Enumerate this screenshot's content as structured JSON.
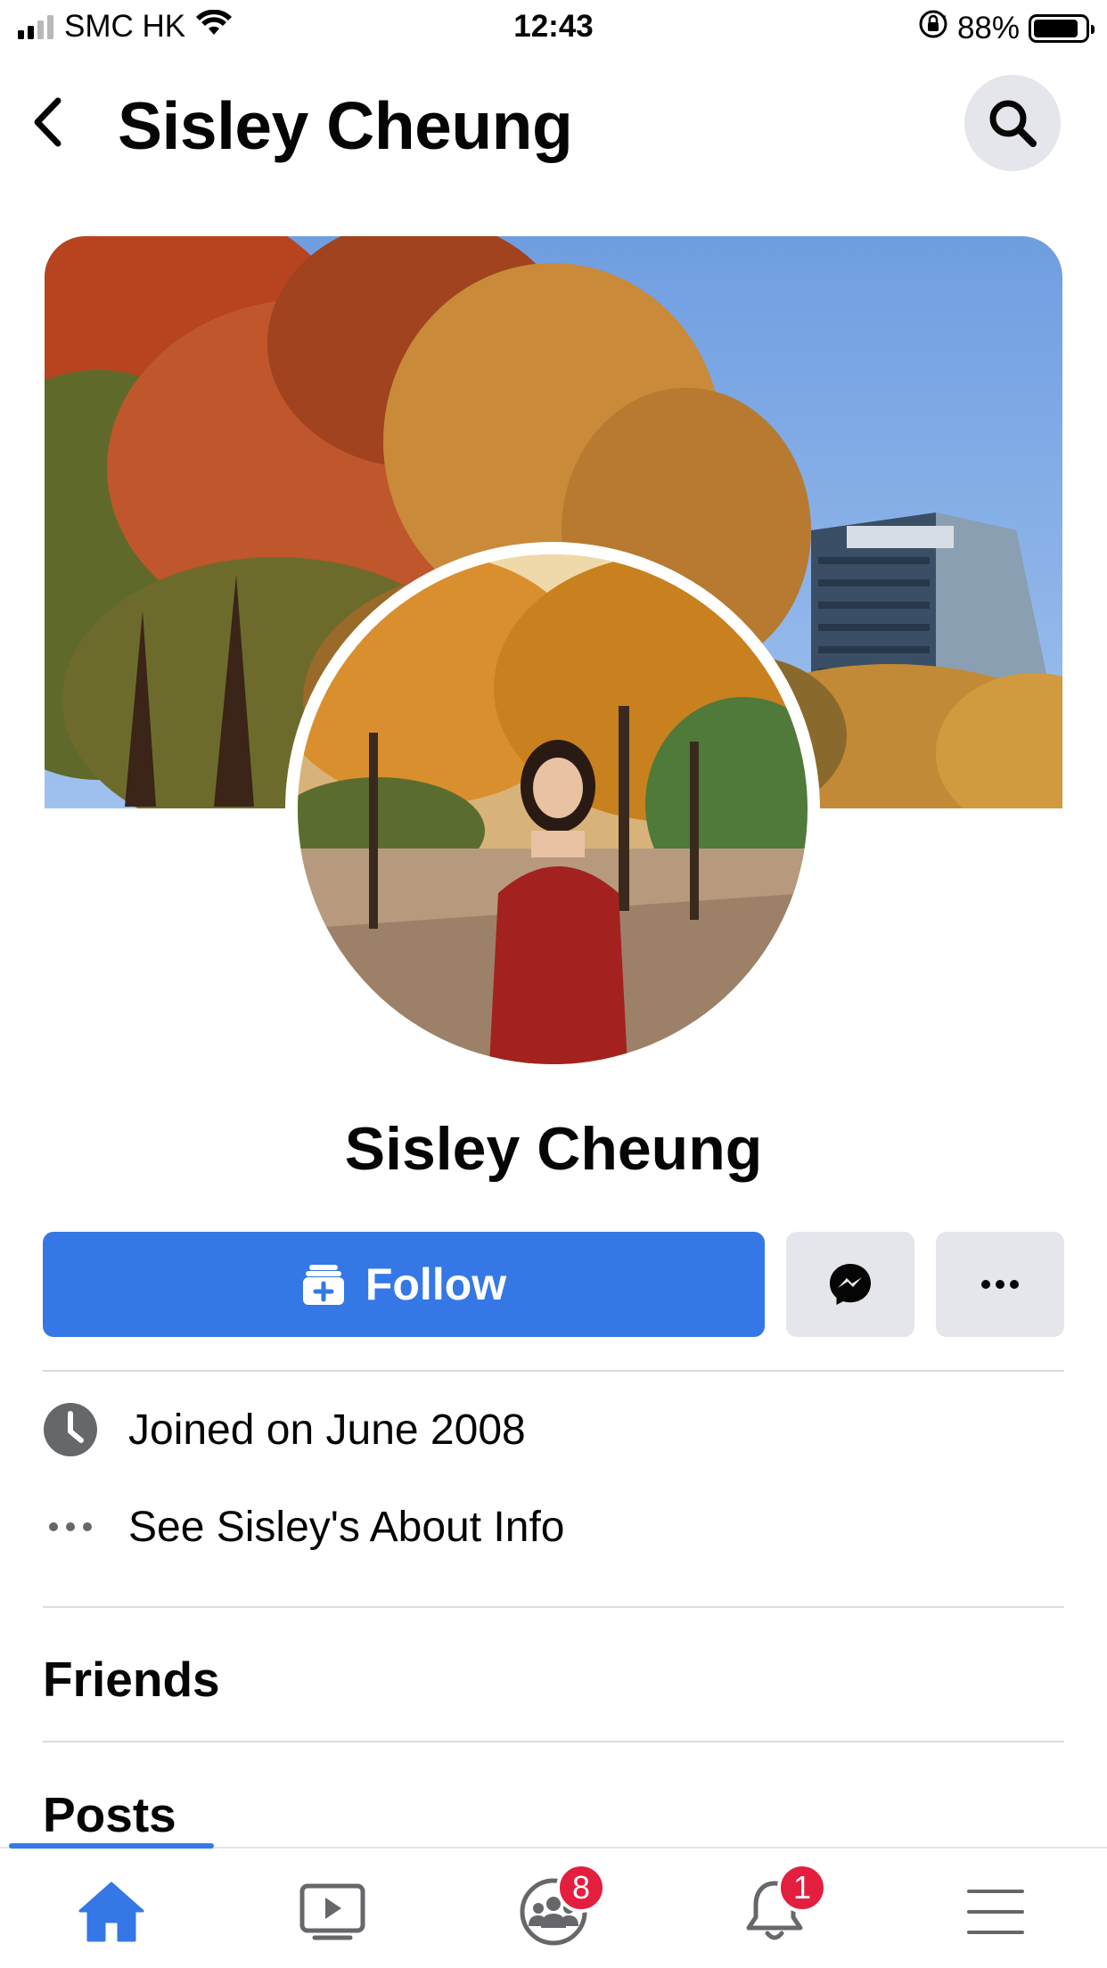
{
  "status_bar": {
    "carrier": "SMC HK",
    "time": "12:43",
    "battery_percent": "88%",
    "battery_level": 0.88,
    "icons": [
      "signal-icon",
      "wifi-icon",
      "orientation-lock-icon",
      "battery-icon"
    ]
  },
  "header": {
    "title": "Sisley Cheung",
    "back_icon": "chevron-left-icon",
    "search_icon": "search-icon"
  },
  "profile": {
    "name": "Sisley Cheung"
  },
  "actions": {
    "follow_label": "Follow",
    "follow_icon": "follow-plus-icon",
    "message_icon": "messenger-icon",
    "more_icon": "more-dots-icon"
  },
  "info": {
    "items": [
      {
        "icon": "clock-icon",
        "text": "Joined on June 2008"
      },
      {
        "icon": "more-dots-icon",
        "text": "See Sisley's About Info"
      }
    ]
  },
  "sections": {
    "friends": "Friends",
    "posts": "Posts"
  },
  "bottom_nav": {
    "items": [
      {
        "name": "home",
        "icon": "home-icon",
        "active": true
      },
      {
        "name": "watch",
        "icon": "video-play-icon"
      },
      {
        "name": "groups",
        "icon": "groups-icon",
        "badge": "8"
      },
      {
        "name": "notifications",
        "icon": "bell-icon",
        "badge": "1"
      },
      {
        "name": "menu",
        "icon": "menu-icon"
      }
    ]
  },
  "colors": {
    "accent": "#3578e5",
    "button_gray": "#e4e6eb",
    "badge_red": "#e41e3f",
    "divider": "#dadde1"
  }
}
